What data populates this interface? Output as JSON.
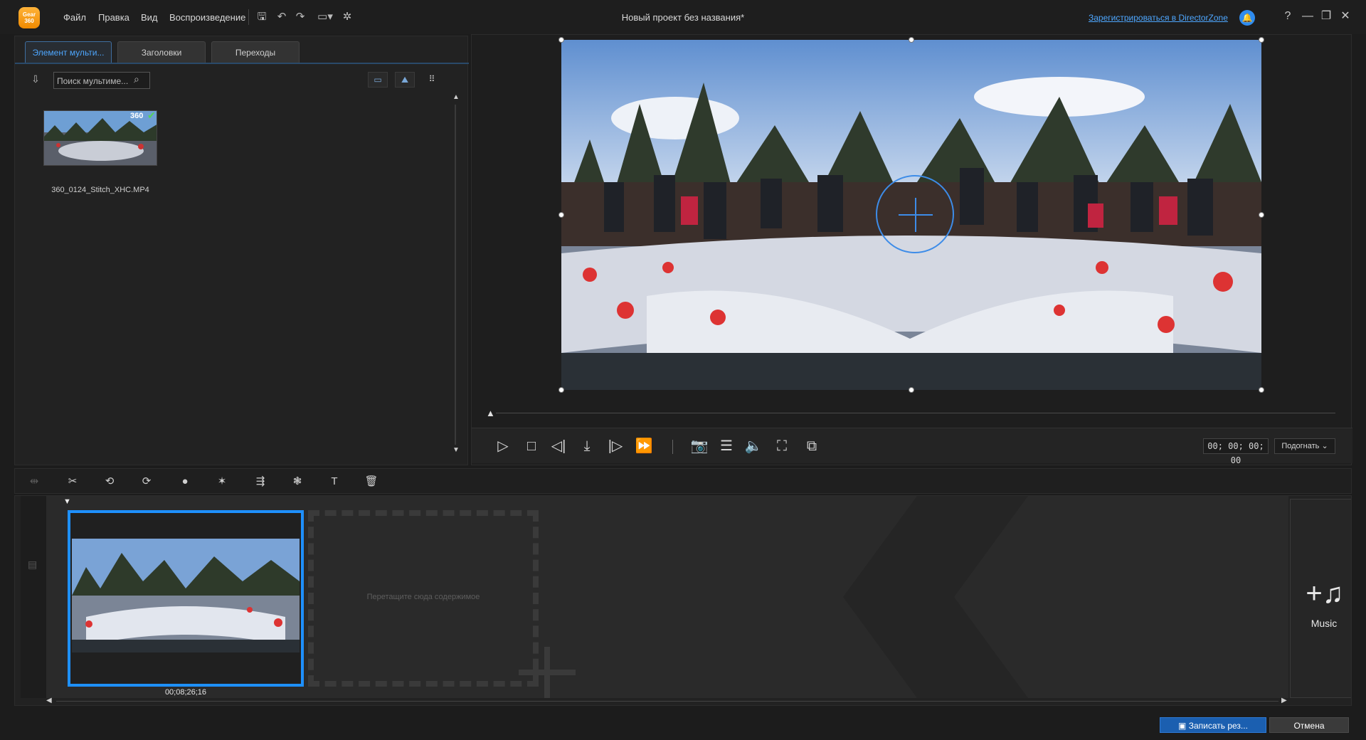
{
  "app": {
    "logo_text": "Gear 360"
  },
  "menu": [
    "Файл",
    "Правка",
    "Вид",
    "Воспроизведение"
  ],
  "toolbar_icons": [
    "save-icon",
    "undo-icon",
    "redo-icon",
    "aspect-ratio-icon",
    "settings-icon"
  ],
  "title": "Новый проект без названия*",
  "header": {
    "register_link": "Зарегистрироваться в DirectorZone",
    "help": "?"
  },
  "window": {
    "minimize": "—",
    "restore": "❐",
    "close": "✕"
  },
  "library": {
    "tabs": [
      "Элемент мульти...",
      "Заголовки",
      "Переходы"
    ],
    "active_tab": 0,
    "search_placeholder": "Поиск мультиме...",
    "media": [
      {
        "name": "360_0124_Stitch_XHC.MP4",
        "badge": "360",
        "checked": true
      }
    ]
  },
  "player": {
    "timecode": "00; 00; 00; 00",
    "fit": "Подогнать"
  },
  "storyboard": {
    "clip_duration": "00;08;26;16",
    "drop_hint": "Перетащите сюда содержимое",
    "music_label": "Music"
  },
  "footer": {
    "record_label": "Записать рез...",
    "cancel_label": "Отмена"
  },
  "colors": {
    "accent": "#1e90ff",
    "link": "#4ea7ff",
    "bg": "#1c1c1c",
    "logo": "#f5a21b"
  }
}
